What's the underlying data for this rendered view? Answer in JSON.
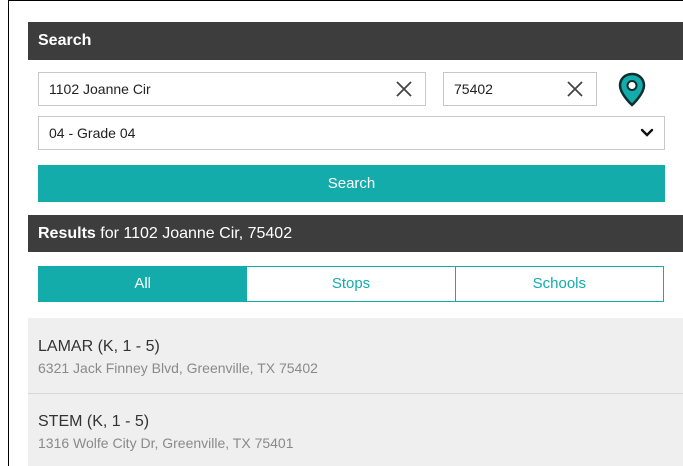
{
  "search": {
    "header": "Search",
    "address_value": "1102 Joanne Cir",
    "zip_value": "75402",
    "grade_selected": "04 - Grade 04",
    "button_label": "Search"
  },
  "results": {
    "header_bold": "Results",
    "header_rest": " for 1102 Joanne Cir, 75402",
    "tabs": [
      {
        "label": "All",
        "active": true
      },
      {
        "label": "Stops",
        "active": false
      },
      {
        "label": "Schools",
        "active": false
      }
    ],
    "items": [
      {
        "name": "LAMAR (K, 1 - 5)",
        "address": "6321 Jack Finney Blvd, Greenville, TX 75402"
      },
      {
        "name": "STEM (K, 1 - 5)",
        "address": "1316 Wolfe City Dr, Greenville, TX 75401"
      }
    ]
  },
  "icons": {
    "clear": "close-icon",
    "location": "map-pin-icon",
    "dropdown": "chevron-down-icon"
  },
  "colors": {
    "accent": "#13acab",
    "header_bg": "#3d3d3d",
    "list_bg": "#efefef"
  }
}
